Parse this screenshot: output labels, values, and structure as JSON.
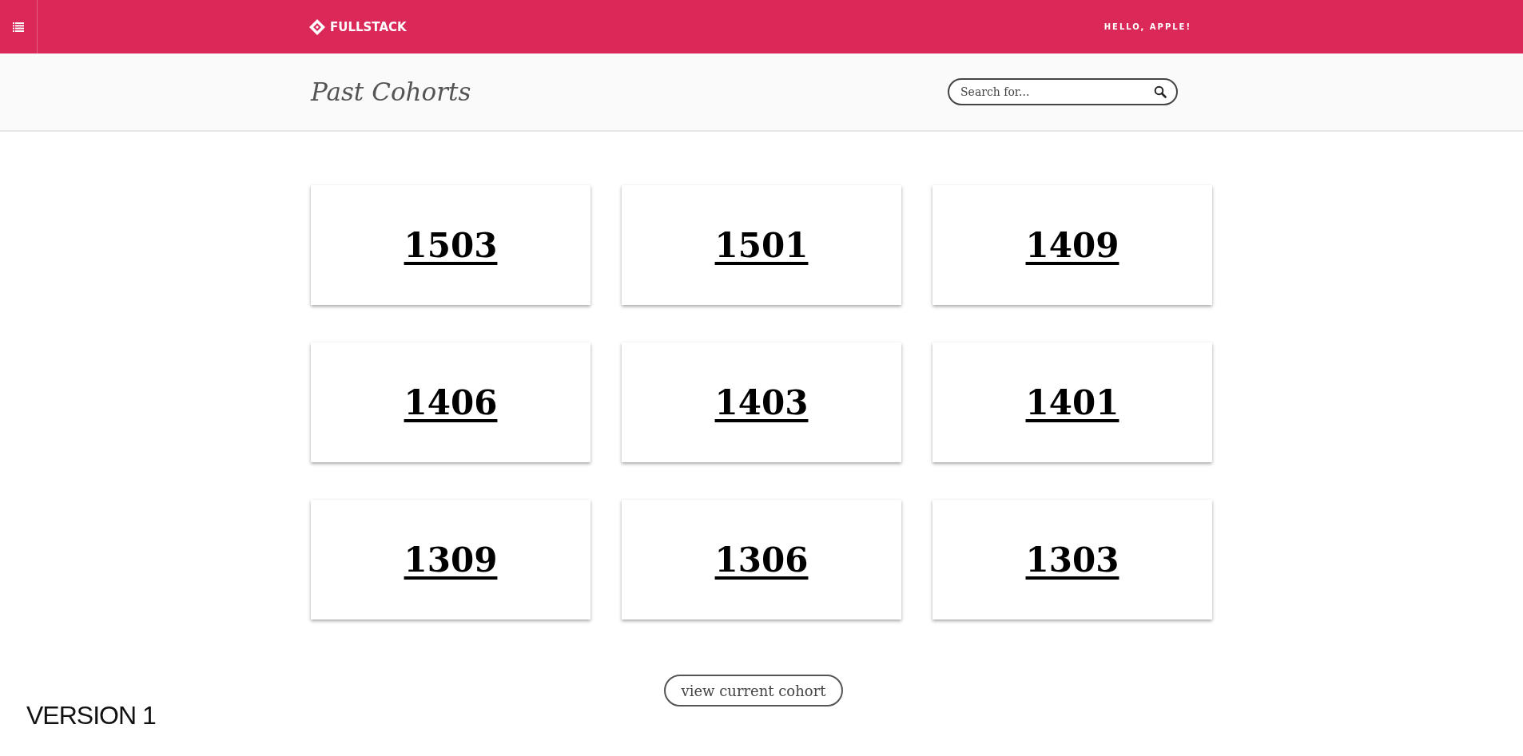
{
  "header": {
    "brand": "FULLSTACK",
    "greeting": "HELLO, APPLE!"
  },
  "page": {
    "title": "Past Cohorts",
    "search": {
      "placeholder": "Search for..."
    }
  },
  "cohorts": [
    "1503",
    "1501",
    "1409",
    "1406",
    "1403",
    "1401",
    "1309",
    "1306",
    "1303"
  ],
  "view_button": "view current cohort",
  "version_label": "VERSION 1"
}
